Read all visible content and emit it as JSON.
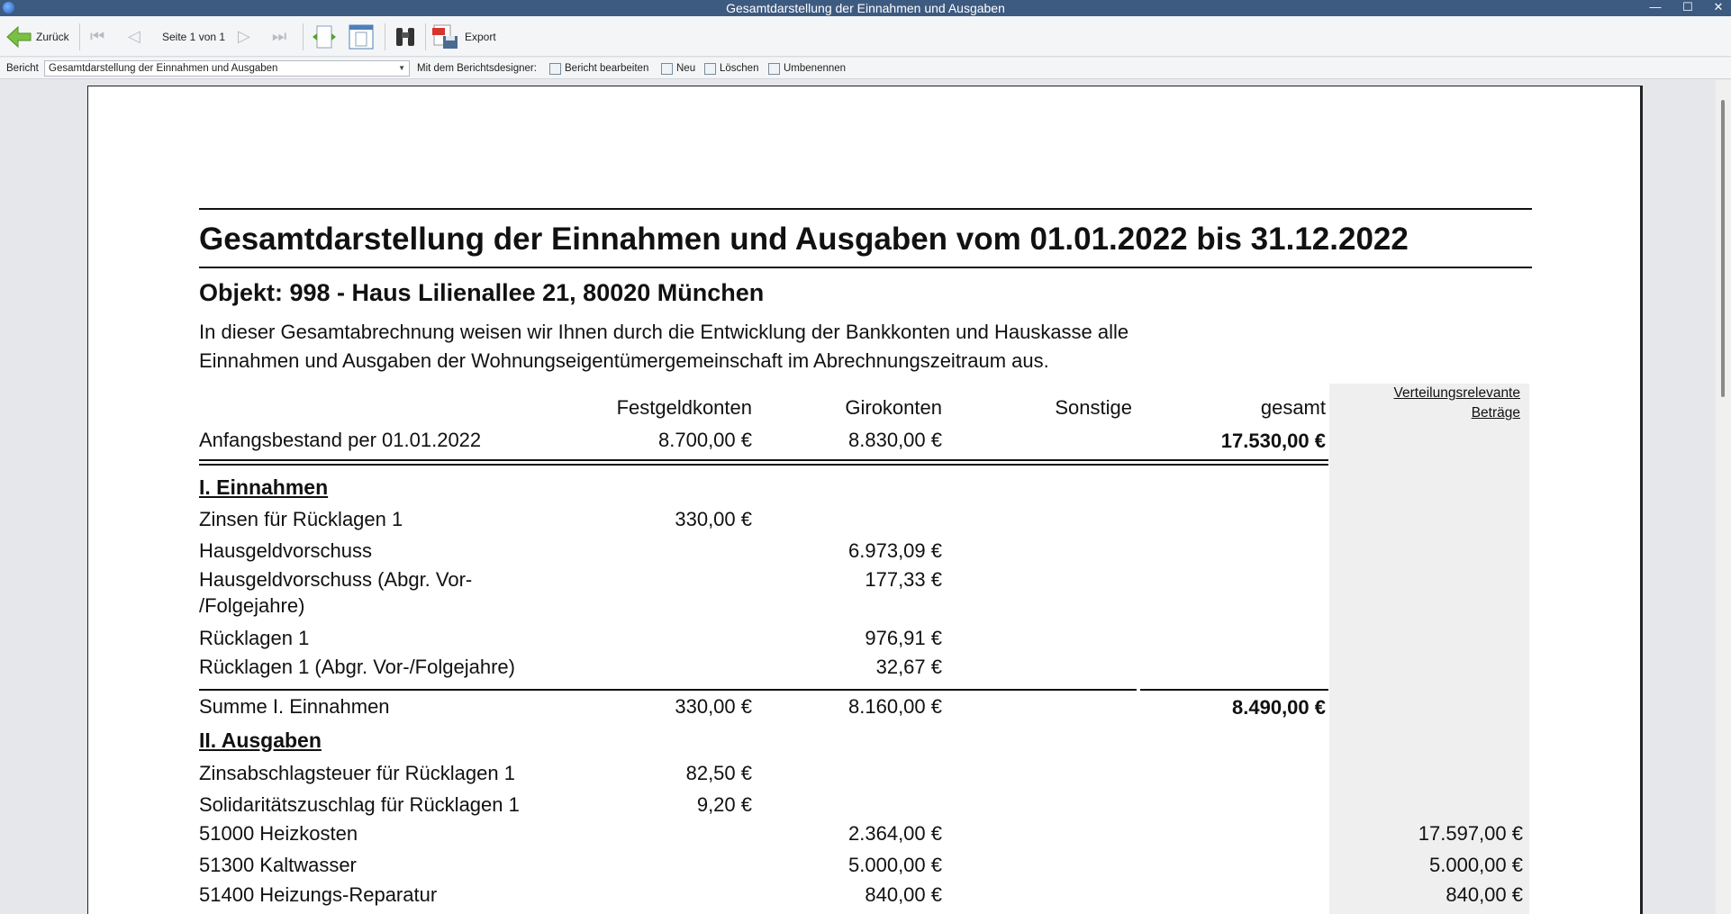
{
  "window": {
    "title": "Gesamtdarstellung der Einnahmen und Ausgaben",
    "minimize": "—",
    "maximize": "☐",
    "close": "✕"
  },
  "toolbar": {
    "back": "Zurück",
    "page_info": "Seite 1 von 1",
    "export": "Export"
  },
  "reportbar": {
    "report_label": "Bericht",
    "report_selected": "Gesamtdarstellung der Einnahmen und Ausgaben",
    "designer_label": "Mit dem Berichtsdesigner:",
    "edit": "Bericht bearbeiten",
    "new": "Neu",
    "delete": "Löschen",
    "rename": "Umbenennen"
  },
  "report": {
    "title": "Gesamtdarstellung der Einnahmen und Ausgaben vom 01.01.2022 bis 31.12.2022",
    "object": "Objekt: 998 - Haus Lilienallee 21, 80020 München",
    "intro_line1": "In dieser Gesamtabrechnung weisen wir Ihnen durch die Entwicklung der Bankkonten und Hauskasse alle",
    "intro_line2": "Einnahmen und Ausgaben der Wohnungseigentümergemeinschaft im Abrechnungszeitraum aus.",
    "columns": {
      "fest": "Festgeldkonten",
      "giro": "Girokonten",
      "sonst": "Sonstige",
      "gesamt": "gesamt",
      "dist1": "Verteilungsrelevante",
      "dist2": "Beträge"
    },
    "opening": {
      "label": "Anfangsbestand per 01.01.2022",
      "fest": "8.700,00 €",
      "giro": "8.830,00 €",
      "gesamt": "17.530,00 €"
    },
    "income_head": "I. Einnahmen",
    "income_rows": [
      {
        "label": "Zinsen für Rücklagen 1",
        "fest": "330,00 €",
        "giro": ""
      },
      {
        "label": "Hausgeldvorschuss",
        "fest": "",
        "giro": "6.973,09 €"
      },
      {
        "label": "Hausgeldvorschuss (Abgr. Vor-",
        "label2": "/Folgejahre)",
        "fest": "",
        "giro": "177,33 €"
      },
      {
        "label": "Rücklagen 1",
        "fest": "",
        "giro": "976,91 €"
      },
      {
        "label": "Rücklagen 1 (Abgr. Vor-/Folgejahre)",
        "fest": "",
        "giro": "32,67 €"
      }
    ],
    "income_sum": {
      "label": "Summe I. Einnahmen",
      "fest": "330,00 €",
      "giro": "8.160,00 €",
      "gesamt": "8.490,00 €"
    },
    "expense_head": "II. Ausgaben",
    "expense_rows": [
      {
        "label": "Zinsabschlagsteuer für Rücklagen 1",
        "fest": "82,50 €",
        "giro": "",
        "dist": ""
      },
      {
        "label": "Solidaritätszuschlag für Rücklagen 1",
        "fest": "9,20 €",
        "giro": "",
        "dist": ""
      },
      {
        "label": "51000 Heizkosten",
        "fest": "",
        "giro": "2.364,00 €",
        "dist": "17.597,00 €"
      },
      {
        "label": "51300 Kaltwasser",
        "fest": "",
        "giro": "5.000,00 €",
        "dist": "5.000,00 €"
      },
      {
        "label": "51400 Heizungs-Reparatur",
        "fest": "",
        "giro": "840,00 €",
        "dist": "840,00 €"
      }
    ]
  }
}
